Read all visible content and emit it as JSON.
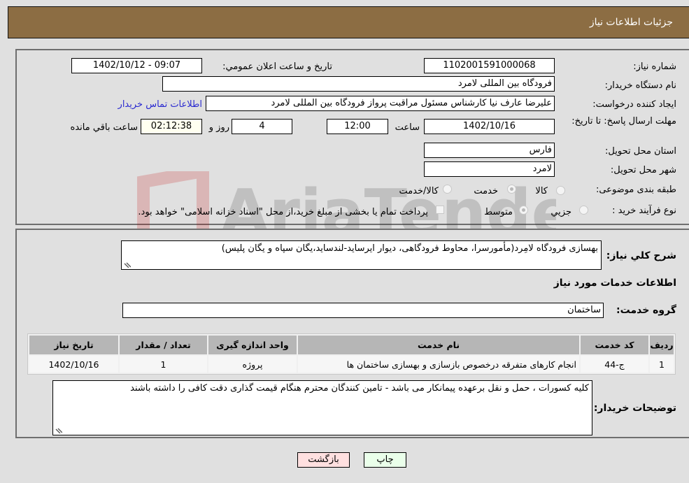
{
  "header": {
    "title": "جزئیات اطلاعات نیاز"
  },
  "form": {
    "need_number": {
      "label": "شماره نیاز:",
      "value": "1102001591000068"
    },
    "announce_datetime": {
      "label": "تاریخ و ساعت اعلان عمومي:",
      "value": "1402/10/12 - 09:07"
    },
    "buyer_org": {
      "label": "نام دستگاه خریدار:",
      "value": "فرودگاه بین المللی لامرد"
    },
    "requester": {
      "label": "ایجاد کننده درخواست:",
      "value": "علیرضا عارف نیا کارشناس مسئول مراقبت پرواز فرودگاه بین المللی لامرد"
    },
    "buyer_contact_link": "اطلاعات تماس خریدار",
    "deadline": {
      "label": "مهلت ارسال پاسخ: تا تاریخ:",
      "date": "1402/10/16",
      "time_label": "ساعت",
      "time": "12:00",
      "days": "4",
      "days_label": "روز و",
      "remaining": "02:12:38",
      "remaining_label": "ساعت باقي مانده"
    },
    "province": {
      "label": "استان محل تحویل:",
      "value": "فارس"
    },
    "city": {
      "label": "شهر محل تحویل:",
      "value": "لامرد"
    },
    "category": {
      "label": "طبقه بندی موضوعی:",
      "options": [
        "کالا",
        "خدمت",
        "کالا/خدمت"
      ],
      "selected": "خدمت"
    },
    "purchase_type": {
      "label": "نوع فرآیند خرید :",
      "options": [
        "جزیي",
        "متوسط"
      ],
      "selected": "متوسط",
      "treasury_note": "پرداخت تمام یا بخشی از مبلغ خرید،از محل \"اسناد خزانه اسلامی\" خواهد بود.",
      "treasury_checked": false
    }
  },
  "details": {
    "general_desc_label": "شرح کلي نیاز:",
    "general_desc": "بهسازی فرودگاه لامِرد(مأمورسرا، محاوط فرودگاهی، دیوار ایرساید-لندساید،یگان سپاه و یگان پلیس)",
    "services_heading": "اطلاعات خدمات مورد نیاز",
    "service_group_label": "گروه خدمت:",
    "service_group": "ساختمان",
    "table": {
      "headers": [
        "ردیف",
        "کد خدمت",
        "نام خدمت",
        "واحد اندازه گیری",
        "تعداد / مقدار",
        "تاریخ نیاز"
      ],
      "rows": [
        [
          "1",
          "ج-44",
          "انجام کارهای متفرقه درخصوص بازسازی و بهسازی ساختمان ها",
          "پروژه",
          "1",
          "1402/10/16"
        ]
      ]
    },
    "buyer_notes_label": "توضیحات خریدار:",
    "buyer_notes": "کلیه کسورات ، حمل و نقل برعهده پیمانکار می باشد - تامین کنندگان محترم هنگام قیمت گذاری دقت کافی را داشته باشند"
  },
  "buttons": {
    "print": "چاپ",
    "back": "بازگشت"
  },
  "colors": {
    "header_bg": "#8c6d43",
    "print_bg": "#eaffea",
    "back_bg": "#ffe0e0",
    "link": "#2a2ad0"
  },
  "watermark": "AriaTender.neT"
}
